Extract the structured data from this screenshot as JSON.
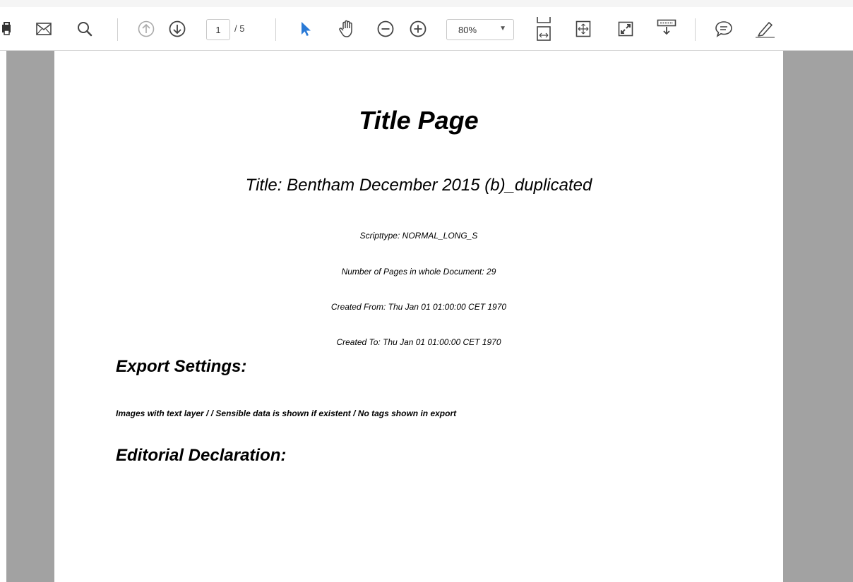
{
  "toolbar": {
    "page": {
      "current": "1",
      "total": "/ 5"
    },
    "zoom": {
      "value": "80%"
    },
    "icons": [
      "print-icon",
      "mail-icon",
      "search-icon",
      "prev-page-icon",
      "next-page-icon",
      "select-cursor-icon",
      "hand-tool-icon",
      "zoom-out-icon",
      "zoom-in-icon",
      "fit-width-icon",
      "fit-page-icon",
      "fullscreen-icon",
      "read-mode-icon",
      "comment-icon",
      "highlight-icon"
    ],
    "accent_color": "#2a7ad6"
  },
  "document": {
    "title": "Title Page",
    "subtitle": "Title: Bentham December 2015 (b)_duplicated",
    "scripttype": "Scripttype: NORMAL_LONG_S",
    "pages": "Number of Pages in whole Document: 29",
    "created_from": "Created From: Thu Jan 01 01:00:00 CET 1970",
    "created_to": "Created To: Thu Jan 01 01:00:00 CET 1970",
    "export_heading": "Export Settings:",
    "export_line": "Images with text layer /  / Sensible data is shown if existent / No tags shown in export",
    "editorial_heading": "Editorial Declaration:"
  }
}
